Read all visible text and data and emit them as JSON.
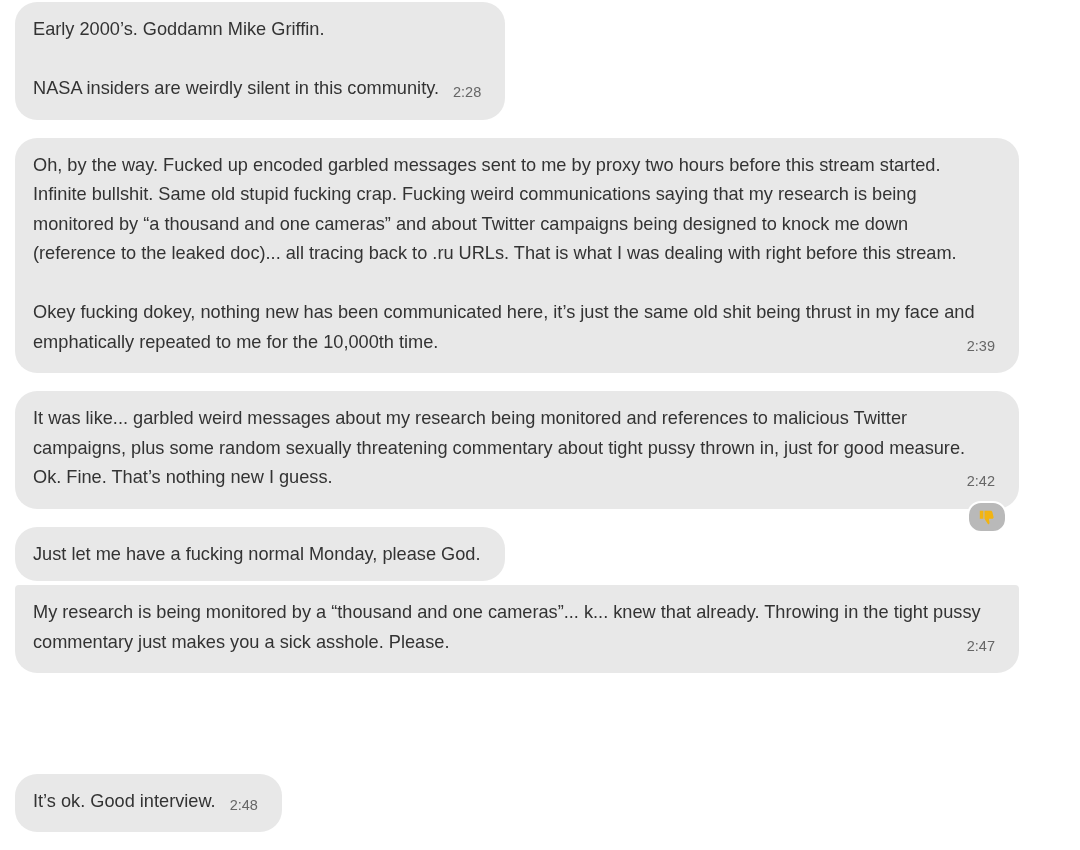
{
  "messages": [
    {
      "paragraphs": [
        "Early 2000’s. Goddamn Mike Griffin.",
        "NASA insiders are weirdly silent in this community."
      ],
      "time": "2:28",
      "continued": false,
      "disliked": false
    },
    {
      "paragraphs": [
        "Oh, by the way. Fucked up encoded garbled messages sent to me by proxy two hours before this stream started. Infinite bullshit. Same old stupid fucking crap. Fucking weird communications saying that my research is being monitored by “a thousand and one cameras” and about Twitter campaigns being designed to knock me down (reference to the leaked doc)... all tracing back to .ru URLs. That is what I was dealing with right before this stream.",
        "Okey fucking dokey, nothing new has been communicated here, it’s just the same old shit being thrust in my face and emphatically repeated to me for the 10,000th time."
      ],
      "time": "2:39",
      "continued": false,
      "disliked": false
    },
    {
      "paragraphs": [
        "It was like... garbled weird messages about my research being monitored and references to malicious Twitter campaigns, plus some random sexually threatening commentary about tight pussy thrown in, just for good measure. Ok. Fine. That’s nothing new I guess."
      ],
      "time": "2:42",
      "continued": false,
      "disliked": true
    },
    {
      "paragraphs": [
        "Just let me have a fucking normal Monday, please God."
      ],
      "continued": false,
      "disliked": false
    },
    {
      "paragraphs": [
        "My research is being monitored by a “thousand and one cameras”... k... knew that already. Throwing in the tight pussy commentary just makes you a sick asshole. Please."
      ],
      "time": "2:47",
      "continued": true,
      "disliked": false
    },
    {
      "paragraphs": [
        "It’s ok. Good interview."
      ],
      "time": "2:48",
      "continued": false,
      "disliked": false
    }
  ]
}
